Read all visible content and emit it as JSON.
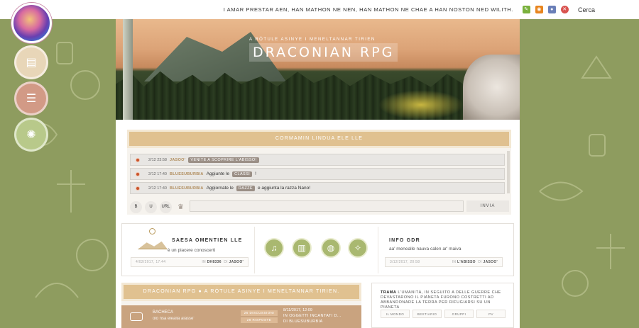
{
  "topbar": {
    "quote": "I AMAR PRESTAR AEN, HAN MATHON NE NEN, HAN MATHON NE CHAE A HAN NOSTON NED WILITH.",
    "search_label": "Cerca",
    "icons": [
      "edit-icon",
      "rss-icon",
      "user-icon",
      "close-icon"
    ]
  },
  "banner": {
    "subtitle": "A RÓTULE ASINYE I MENELTANNAR TIRIEN",
    "title": "DRACONIAN RPG"
  },
  "chat": {
    "header": "CORMAMIN LINDUA ELE LLE",
    "messages": [
      {
        "time": "2/12 23:58",
        "user": "JASOO'",
        "tag": "VENITE A SCOPRIRE L'ABISSO!",
        "text": ""
      },
      {
        "time": "2/12 17:40",
        "user": "BLUESUBURBIA",
        "text_before": "Aggiunte le",
        "tag": "CLASSI",
        "text_after": "!"
      },
      {
        "time": "2/12 17:40",
        "user": "BLUESUBURBIA",
        "text_before": "Aggiornate le",
        "tag": "RAZZE",
        "text_after": "e aggiunta la razza Nano!"
      }
    ],
    "tools": [
      "B",
      "U",
      "URL"
    ],
    "send_label": "INVIA"
  },
  "welcome": {
    "title": "SAESA OMENTIEN LLE",
    "subtitle": "è un piacere conoscerti",
    "date": "4/02/2017, 17:44",
    "by_label": "IN",
    "by_value": "DH8336",
    "user_label": "DI",
    "user_value": "JASOO'"
  },
  "quicklinks": [
    "music-icon",
    "book-icon",
    "globe-icon",
    "dragon-icon"
  ],
  "info_gdr": {
    "title": "INFO GDR",
    "subtitle": "aa' menealle nauva calen ar' maiva",
    "date": "3/12/2017, 20:58",
    "by_label": "IN",
    "by_value": "L'ABISSO",
    "user_label": "DI",
    "user_value": "JASOO'"
  },
  "forum": {
    "header": "DRACONIAN RPG  ●  A RÓTULE ASINYE I MENELTANNAR TIRIEN.",
    "row": {
      "name": "BACHECA",
      "desc": "olo nsa elealla alasse'",
      "discussions": "26 DISCUSSIONI",
      "replies": "28 RISPOSTE",
      "last_date": "8/11/2017, 12:09",
      "last_in_label": "IN",
      "last_topic": "OGGETTI INCANTATI D...",
      "last_by_label": "DI",
      "last_user": "BLUESUBURBIA"
    }
  },
  "trama": {
    "label": "TRAMA",
    "text": "L'UMANITÀ, IN SEGUITO A DELLE GUERRE CHE DEVASTARONO IL PIANETA FURONO COSTRETTI AD ABBANDONARE LA TERRA PER RIFUGIARSI SU UN PIANETA",
    "tabs": [
      "IL MONDO",
      "BESTIARIO",
      "GRUPPI",
      "PV"
    ]
  },
  "colors": {
    "accent": "#e0c190",
    "side_btn_1": "#e8d6b8",
    "side_btn_2": "#d29a86",
    "side_btn_3": "#b8c98a",
    "olive": "#8e9c5f"
  }
}
